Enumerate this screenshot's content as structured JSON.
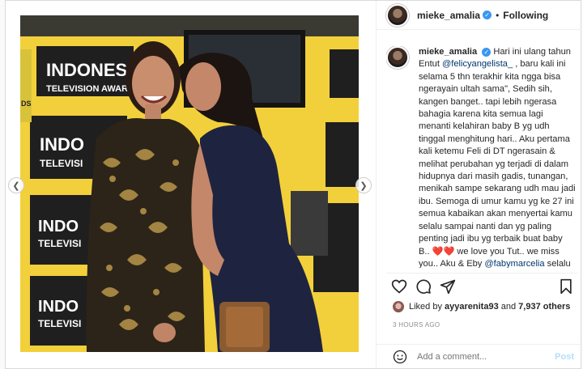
{
  "header": {
    "username": "mieke_amalia",
    "dot": "•",
    "follow_status": "Following",
    "more_icon": "more-horizontal-icon"
  },
  "caption": {
    "username": "mieke_amalia",
    "text_1": "Hari ini ulang tahun Entut ",
    "mention_1": "@felicyangelista_",
    "text_2": " , baru kali ini selama 5 thn terakhir kita ngga bisa ngerayain ultah sama\", Sedih sih, kangen banget.. tapi lebih ngerasa bahagia karena kita semua lagi menanti kelahiran baby B yg udh tinggal menghitung hari.. Aku pertama kali ketemu Feli di DT ngerasain & melihat perubahan yg terjadi di dalam hidupnya dari masih gadis, tunangan, menikah sampe sekarang udh mau jadi ibu. Semoga di umur kamu yg ke 27 ini semua kabaikan akan menyertai kamu selalu sampai nanti dan yg paling penting jadi ibu yg terbaik buat baby B.. ",
    "hearts": "❤️❤️",
    "text_3": " we love you Tut.. we miss you.. Aku & Eby ",
    "mention_2": "@fabymarcelia",
    "text_4": " selalu doain kamu walaupun kita ngga ketemu dulu ya demi kebaikan untuk semua.. sampe"
  },
  "actions": {
    "like_icon": "heart-icon",
    "comment_icon": "comment-icon",
    "share_icon": "share-icon",
    "save_icon": "bookmark-icon"
  },
  "likes": {
    "prefix": "Liked by ",
    "user": "ayyarenita93",
    "middle": " and ",
    "count": "7,937 others"
  },
  "timestamp": "3 HOURS AGO",
  "comment": {
    "placeholder": "Add a comment...",
    "post_label": "Post",
    "emoji_icon": "smile-icon"
  },
  "photo": {
    "banner_lines": [
      [
        "INDONESIA",
        "TELEVISION AWARDS"
      ],
      [
        "INDO",
        "TELEVISI"
      ],
      [
        "INDO",
        "TELEVISI"
      ],
      [
        "INDO",
        "TELEVISI"
      ]
    ],
    "left_edge_text": "DS"
  },
  "colors": {
    "accent": "#3897f0",
    "heart": "#e0202b",
    "mention": "#00376b",
    "banner_yellow": "#f2d03b"
  }
}
